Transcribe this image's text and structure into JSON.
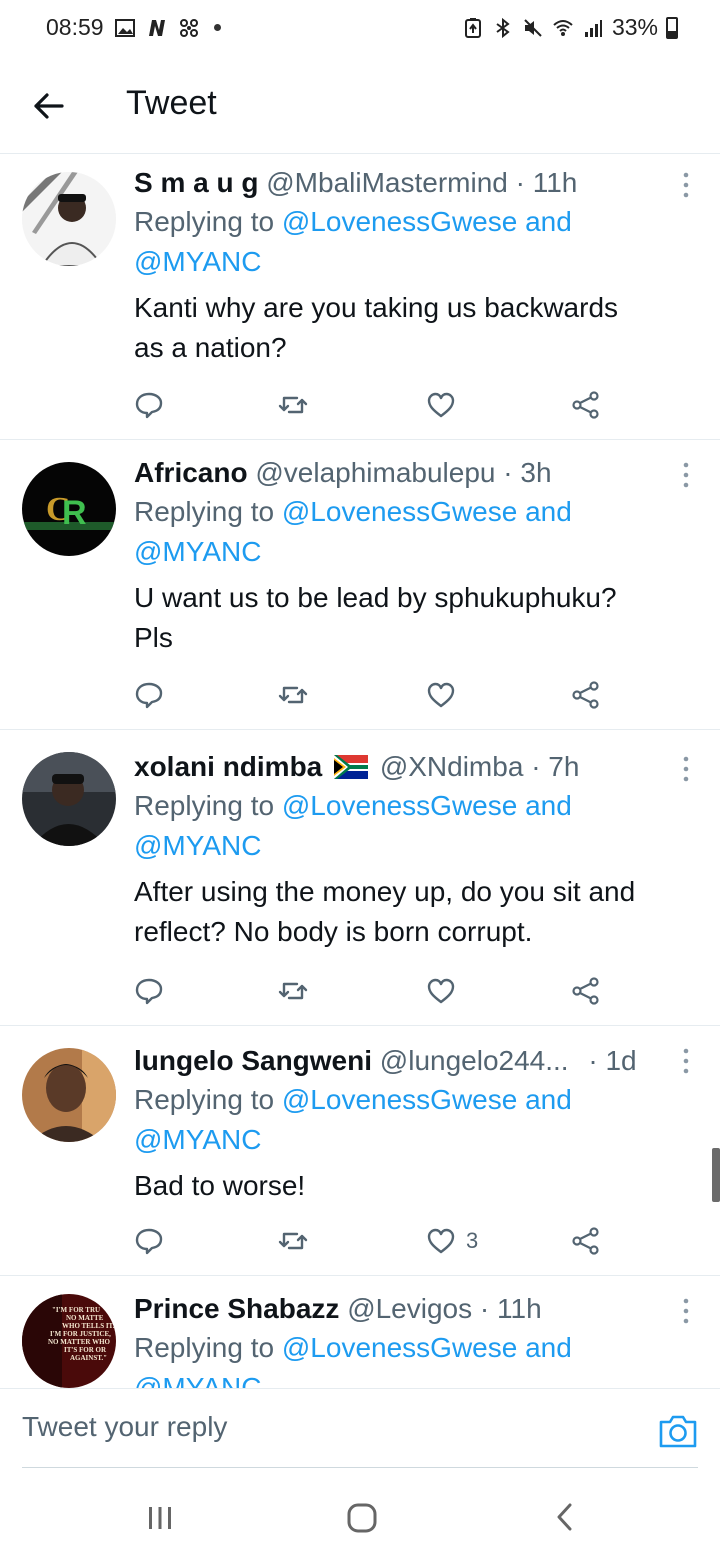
{
  "status_bar": {
    "time": "08:59",
    "battery": "33%"
  },
  "header": {
    "title": "Tweet"
  },
  "tweets": [
    {
      "name": "S m a u g",
      "handle": "@MbaliMastermind",
      "time": "· 11h",
      "replying_prefix": "Replying to",
      "mention_1": "@LovenessGwese and",
      "mention_2": "@MYANC",
      "text_line_1": "Kanti why are you taking us backwards",
      "text_line_2": "as a nation?",
      "likes": ""
    },
    {
      "name": "Africano",
      "handle": "@velaphimabulepu",
      "time": "· 3h",
      "replying_prefix": "Replying to",
      "mention_1": "@LovenessGwese and",
      "mention_2": "@MYANC",
      "text_line_1": "U want us to be lead by sphukuphuku?",
      "text_line_2": "Pls",
      "likes": ""
    },
    {
      "name": "xolani ndimba",
      "handle": "@XNdimba",
      "time": "· 7h",
      "replying_prefix": "Replying to",
      "mention_1": "@LovenessGwese and",
      "mention_2": "@MYANC",
      "text_line_1": "After using the money up, do you sit and",
      "text_line_2": "reflect? No body is born corrupt.",
      "likes": ""
    },
    {
      "name": "lungelo Sangweni",
      "handle": "@lungelo244...",
      "time": "· 1d",
      "replying_prefix": "Replying to",
      "mention_1": "@LovenessGwese and",
      "mention_2": "@MYANC",
      "text_line_1": "Bad to worse!",
      "text_line_2": "",
      "likes": "3"
    },
    {
      "name": "Prince Shabazz",
      "handle": "@Levigos",
      "time": "· 11h",
      "replying_prefix": "Replying to",
      "mention_1": "@LovenessGwese and",
      "mention_2": "@MYANC",
      "text_line_1": "",
      "text_line_2": "",
      "likes": ""
    }
  ],
  "reply_bar": {
    "placeholder": "Tweet your reply"
  },
  "colors": {
    "accent": "#1d9bf0",
    "secondary_text": "#536471",
    "primary_text": "#0f1419",
    "divider": "#e6ecf0"
  },
  "icons": {
    "back": "arrow-left-icon",
    "more": "more-vertical-icon",
    "reply": "reply-bubble-icon",
    "retweet": "retweet-icon",
    "like": "heart-icon",
    "share": "share-icon",
    "camera": "camera-icon"
  }
}
